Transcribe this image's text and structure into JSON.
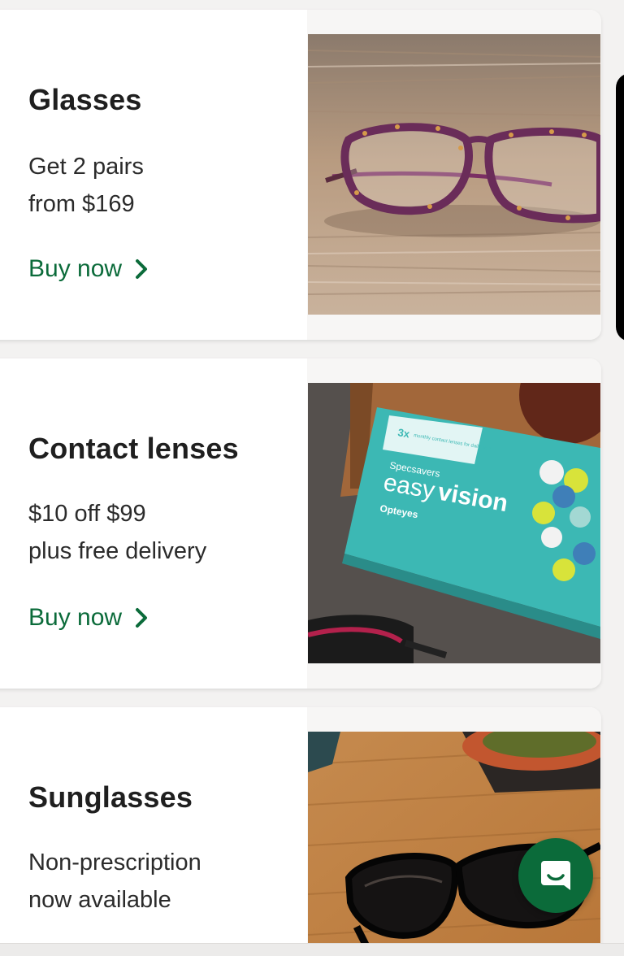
{
  "cards": [
    {
      "title": "Glasses",
      "desc_line1": "Get 2 pairs",
      "desc_line2": "from $169",
      "cta": "Buy now",
      "image": "purple-tortoiseshell-glasses-on-wood"
    },
    {
      "title": "Contact lenses",
      "desc_line1": "$10 off $99",
      "desc_line2": "plus free delivery",
      "cta": "Buy now",
      "image": "easyvision-contact-lens-box",
      "box": {
        "count": "3x",
        "subtitle": "monthly contact lenses for daily wear",
        "brand": "Specsavers",
        "product_light": "easy",
        "product_bold": "vision",
        "maker": "Opteyes"
      }
    },
    {
      "title": "Sunglasses",
      "desc_line1": "Non-prescription",
      "desc_line2": "now available",
      "cta": "",
      "image": "black-sunglasses-on-table"
    }
  ],
  "chat": {
    "icon": "chat-bubble-icon"
  },
  "colors": {
    "accent": "#0b6b3a",
    "title": "#1f1f1f",
    "body": "#2b2b2b"
  }
}
